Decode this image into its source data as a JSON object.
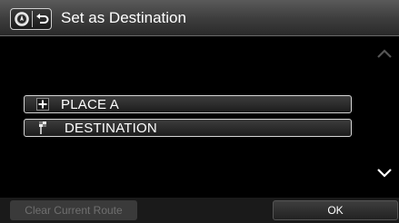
{
  "header": {
    "title": "Set as Destination",
    "nav_icon": "compass-icon",
    "back_icon": "back-arrow-icon"
  },
  "list": {
    "items": [
      {
        "label": "PLACE A",
        "icon": "plus-icon"
      },
      {
        "label": "DESTINATION",
        "icon": "destination-flag-icon"
      }
    ],
    "scroll_up_icon": "chevron-up-icon",
    "scroll_down_icon": "chevron-down-icon"
  },
  "footer": {
    "clear_label": "Clear Current Route",
    "ok_label": "OK"
  }
}
